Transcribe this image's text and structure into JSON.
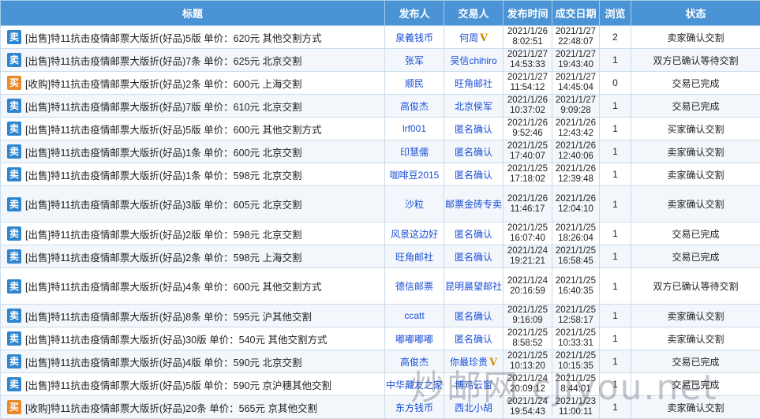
{
  "header": {
    "title": "标题",
    "poster": "发布人",
    "trader": "交易人",
    "post_time": "发布时间",
    "deal_date": "成交日期",
    "views": "浏览",
    "status": "状态"
  },
  "badges": {
    "sell": "卖",
    "buy": "买"
  },
  "colors": {
    "header_bg": "#4a93d4",
    "sell_badge": "#2f86cf",
    "buy_badge": "#e8892b",
    "link": "#1a4ed8"
  },
  "rows": [
    {
      "kind": "sell",
      "title": "[出售]特11抗击疫情邮票大版折(好品)5版 单价：620元 其他交割方式",
      "poster": "泉義钱币",
      "trader": "何周",
      "vip": "V",
      "post_date": "2021/1/26",
      "post_clock": "8:02:51",
      "deal_date": "2021/1/27",
      "deal_clock": "22:48:07",
      "views": "2",
      "status": "卖家确认交割"
    },
    {
      "kind": "sell",
      "title": "[出售]特11抗击疫情邮票大版折(好品)7条 单价：625元 北京交割",
      "poster": "张军",
      "trader": "吴信chihiro",
      "vip": "",
      "post_date": "2021/1/27",
      "post_clock": "14:53:33",
      "deal_date": "2021/1/27",
      "deal_clock": "19:43:40",
      "views": "1",
      "status": "双方已确认等待交割"
    },
    {
      "kind": "buy",
      "title": "[收购]特11抗击疫情邮票大版折(好品)2条 单价：600元 上海交割",
      "poster": "顺民",
      "trader": "旺角邮社",
      "vip": "",
      "post_date": "2021/1/27",
      "post_clock": "11:54:12",
      "deal_date": "2021/1/27",
      "deal_clock": "14:45:04",
      "views": "0",
      "status": "交易已完成"
    },
    {
      "kind": "sell",
      "title": "[出售]特11抗击疫情邮票大版折(好品)7版 单价：610元 北京交割",
      "poster": "高俊杰",
      "trader": "北京侯军",
      "vip": "",
      "post_date": "2021/1/26",
      "post_clock": "10:37:02",
      "deal_date": "2021/1/27",
      "deal_clock": "9:09:28",
      "views": "1",
      "status": "交易已完成"
    },
    {
      "kind": "sell",
      "title": "[出售]特11抗击疫情邮票大版折(好品)5版 单价：600元 其他交割方式",
      "poster": "lrf001",
      "trader": "匿名确认",
      "vip": "",
      "post_date": "2021/1/26",
      "post_clock": "9:52:46",
      "deal_date": "2021/1/26",
      "deal_clock": "12:43:42",
      "views": "1",
      "status": "买家确认交割"
    },
    {
      "kind": "sell",
      "title": "[出售]特11抗击疫情邮票大版折(好品)1条 单价：600元 北京交割",
      "poster": "印慧儒",
      "trader": "匿名确认",
      "vip": "",
      "post_date": "2021/1/25",
      "post_clock": "17:40:07",
      "deal_date": "2021/1/26",
      "deal_clock": "12:40:06",
      "views": "1",
      "status": "卖家确认交割"
    },
    {
      "kind": "sell",
      "title": "[出售]特11抗击疫情邮票大版折(好品)1条 单价：598元 北京交割",
      "poster": "咖啡豆2015",
      "trader": "匿名确认",
      "vip": "",
      "post_date": "2021/1/25",
      "post_clock": "17:18:02",
      "deal_date": "2021/1/26",
      "deal_clock": "12:39:48",
      "views": "1",
      "status": "卖家确认交割"
    },
    {
      "kind": "sell",
      "title": "[出售]特11抗击疫情邮票大版折(好品)3版 单价：605元 北京交割",
      "poster": "沙粒",
      "trader": "邮票金砖专卖",
      "vip": "",
      "post_date": "2021/1/26",
      "post_clock": "11:46:17",
      "deal_date": "2021/1/26",
      "deal_clock": "12:04:10",
      "views": "1",
      "status": "卖家确认交割"
    },
    {
      "kind": "sell",
      "title": "[出售]特11抗击疫情邮票大版折(好品)2版 单价：598元 北京交割",
      "poster": "风景这边好",
      "trader": "匿名确认",
      "vip": "",
      "post_date": "2021/1/25",
      "post_clock": "16:07:40",
      "deal_date": "2021/1/25",
      "deal_clock": "18:26:04",
      "views": "1",
      "status": "交易已完成"
    },
    {
      "kind": "sell",
      "title": "[出售]特11抗击疫情邮票大版折(好品)2条 单价：598元 上海交割",
      "poster": "旺角邮社",
      "trader": "匿名确认",
      "vip": "",
      "post_date": "2021/1/24",
      "post_clock": "19:21:21",
      "deal_date": "2021/1/25",
      "deal_clock": "16:58:45",
      "views": "1",
      "status": "交易已完成"
    },
    {
      "kind": "sell",
      "title": "[出售]特11抗击疫情邮票大版折(好品)4条 单价：600元 其他交割方式",
      "poster": "德信邮票",
      "trader": "昆明晨望邮社",
      "vip": "",
      "post_date": "2021/1/24",
      "post_clock": "20:16:59",
      "deal_date": "2021/1/25",
      "deal_clock": "16:40:35",
      "views": "1",
      "status": "双方已确认等待交割"
    },
    {
      "kind": "sell",
      "title": "[出售]特11抗击疫情邮票大版折(好品)8条 单价：595元 沪其他交割",
      "poster": "ccatt",
      "trader": "匿名确认",
      "vip": "",
      "post_date": "2021/1/25",
      "post_clock": "9:16:09",
      "deal_date": "2021/1/25",
      "deal_clock": "12:58:17",
      "views": "1",
      "status": "卖家确认交割"
    },
    {
      "kind": "sell",
      "title": "[出售]特11抗击疫情邮票大版折(好品)30版 单价：540元 其他交割方式",
      "poster": "嘟嘟嘟嘟",
      "trader": "匿名确认",
      "vip": "",
      "post_date": "2021/1/25",
      "post_clock": "8:58:52",
      "deal_date": "2021/1/25",
      "deal_clock": "10:33:31",
      "views": "1",
      "status": "卖家确认交割"
    },
    {
      "kind": "sell",
      "title": "[出售]特11抗击疫情邮票大版折(好品)4版 单价：590元 北京交割",
      "poster": "高俊杰",
      "trader": "你最珍贵",
      "vip": "V",
      "post_date": "2021/1/25",
      "post_clock": "10:13:20",
      "deal_date": "2021/1/25",
      "deal_clock": "10:15:35",
      "views": "1",
      "status": "交易已完成"
    },
    {
      "kind": "sell",
      "title": "[出售]特11抗击疫情邮票大版折(好品)5版 单价：590元 京沪穗其他交割",
      "poster": "中华藏友之家",
      "trader": "博鸡云窗",
      "vip": "",
      "post_date": "2021/1/24",
      "post_clock": "20:09:12",
      "deal_date": "2021/1/25",
      "deal_clock": "8:44:01",
      "views": "1",
      "status": "交易已完成"
    },
    {
      "kind": "buy",
      "title": "[收购]特11抗击疫情邮票大版折(好品)20条 单价：565元 京其他交割",
      "poster": "东方钱币",
      "trader": "西北小胡",
      "vip": "",
      "post_date": "2021/1/24",
      "post_clock": "19:54:43",
      "deal_date": "2021/1/23",
      "deal_clock": "11:00:11",
      "views": "1",
      "status": "卖家确认交割"
    }
  ],
  "watermark": "炒邮网 cjiyou.net"
}
